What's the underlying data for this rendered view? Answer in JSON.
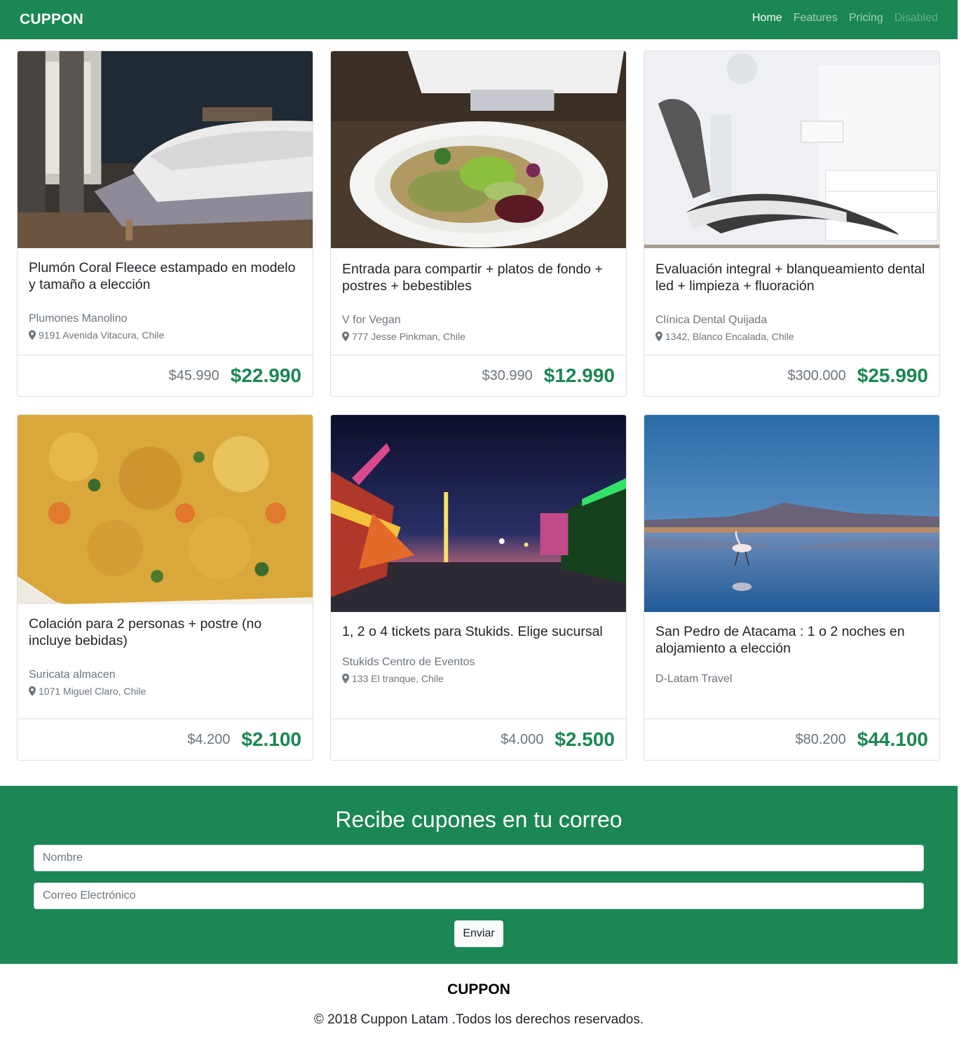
{
  "brand": "CUPPON",
  "nav": {
    "home": "Home",
    "features": "Features",
    "pricing": "Pricing",
    "disabled": "Disabled"
  },
  "colors": {
    "primary": "#1b8754",
    "muted": "#6c757d"
  },
  "deals": [
    {
      "title": "Plumón Coral Fleece estampado en modelo y tamaño a elección",
      "merchant": "Plumones Manolino",
      "address": "9191 Avenida Vitacura, Chile",
      "old_price": "$45.990",
      "new_price": "$22.990",
      "image": "bedroom-photo"
    },
    {
      "title": "Entrada para compartir + platos de fondo + postres + bebestibles",
      "merchant": "V for Vegan",
      "address": "777 Jesse Pinkman, Chile",
      "old_price": "$30.990",
      "new_price": "$12.990",
      "image": "salad-plate-photo"
    },
    {
      "title": "Evaluación integral + blanqueamiento dental led + limpieza + fluoración",
      "merchant": "Clínica Dental Quijada",
      "address": "1342, Blanco Encalada, Chile",
      "old_price": "$300.000",
      "new_price": "$25.990",
      "image": "dental-chair-photo"
    },
    {
      "title": "Colación para 2 personas + postre (no incluye bebidas)",
      "merchant": "Suricata almacen",
      "address": "1071 Miguel Claro, Chile",
      "old_price": "$4.200",
      "new_price": "$2.100",
      "image": "food-closeup-photo"
    },
    {
      "title": "1, 2 o 4 tickets para Stukids. Elige sucursal",
      "merchant": "Stukids Centro de Eventos",
      "address": "133 El tranque, Chile",
      "old_price": "$4.000",
      "new_price": "$2.500",
      "image": "fair-night-photo"
    },
    {
      "title": "San Pedro de Atacama : 1 o 2 noches en alojamiento a elección",
      "merchant": "D-Latam Travel",
      "address": "",
      "old_price": "$80.200",
      "new_price": "$44.100",
      "image": "flamingo-lake-photo"
    }
  ],
  "newsletter": {
    "title": "Recibe cupones en tu correo",
    "name_placeholder": "Nombre",
    "email_placeholder": "Correo Electrónico",
    "submit_label": "Enviar"
  },
  "footer": {
    "brand": "CUPPON",
    "copyright": "© 2018 Cuppon Latam .Todos los derechos reservados."
  }
}
